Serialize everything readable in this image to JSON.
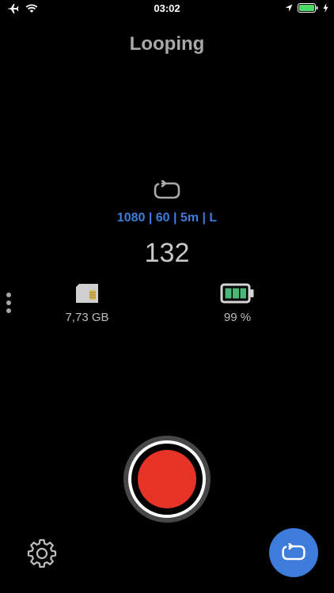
{
  "status_bar": {
    "time": "03:02",
    "icons": [
      "airplane-icon",
      "wifi-icon",
      "location-arrow-icon",
      "battery-icon",
      "charging-bolt-icon"
    ]
  },
  "header": {
    "title": "Looping"
  },
  "recording": {
    "settings_summary": "1080 | 60 | 5m | L",
    "counter": "132",
    "mode_icon": "loop-icon"
  },
  "stats": {
    "storage": {
      "icon": "sd-card-icon",
      "value": "7,73 GB"
    },
    "battery": {
      "icon": "battery-icon",
      "value": "99 %"
    }
  },
  "controls": {
    "record_icon": "record-icon",
    "settings_icon": "gear-icon",
    "mode_icon": "loop-icon",
    "more_icon": "more-vertical-icon"
  },
  "colors": {
    "background": "#000000",
    "accent_blue": "#3d7cdb",
    "record_red": "#e53427",
    "title_gray": "#a9a9a9",
    "status_battery_green": "#4cd964"
  }
}
